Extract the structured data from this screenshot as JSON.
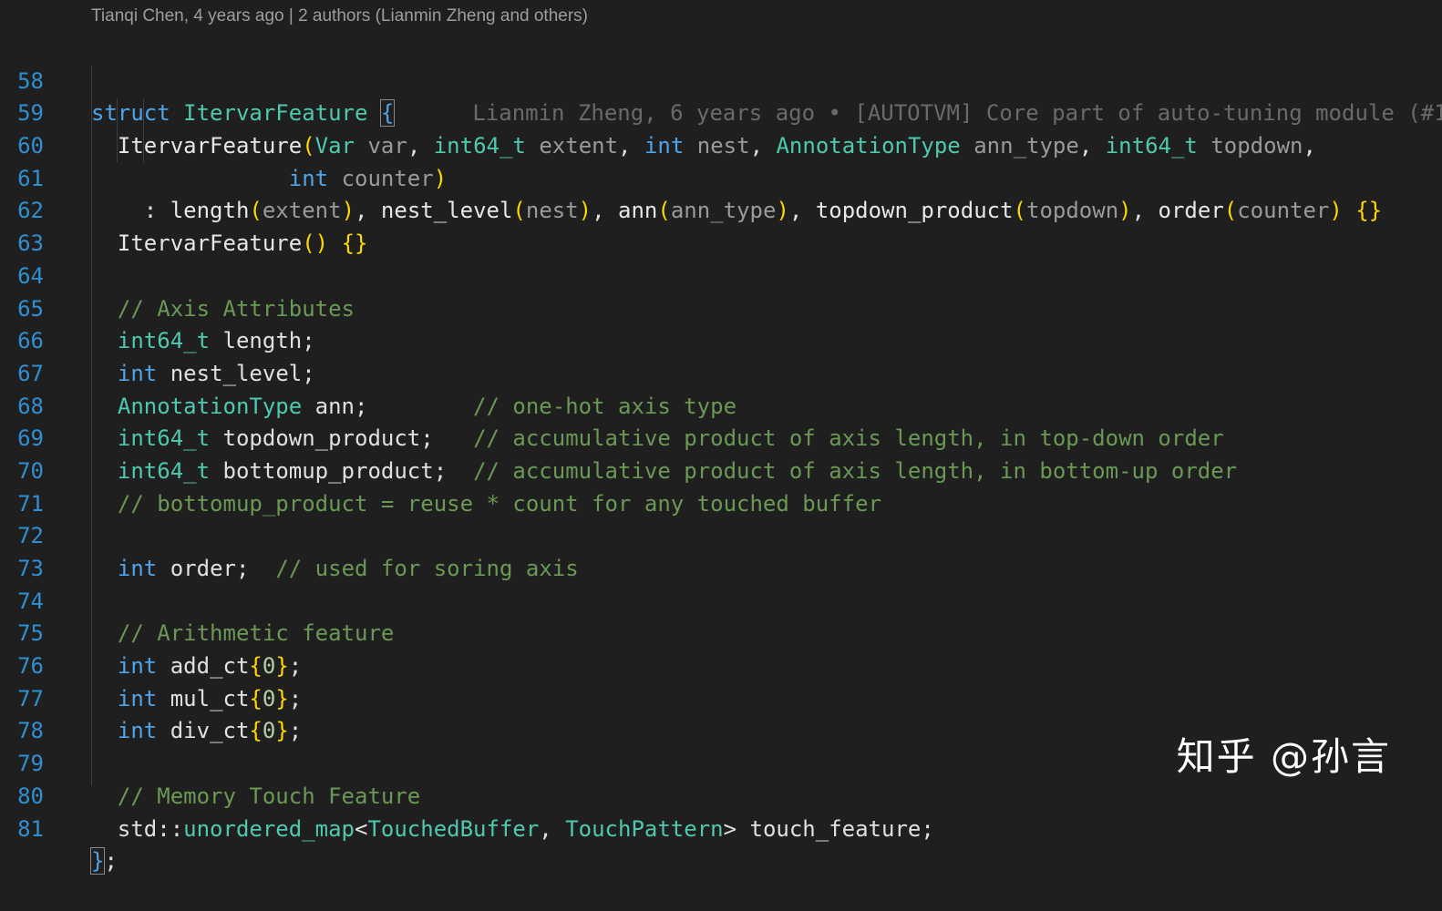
{
  "codelens": "Tianqi Chen, 4 years ago | 2 authors (Lianmin Zheng and others)",
  "blame": "Lianmin Zheng, 6 years ago • [AUTOTVM] Core part of auto-tuning module (#1",
  "watermark": "知乎 @孙言",
  "line_numbers": [
    "58",
    "59",
    "60",
    "61",
    "62",
    "63",
    "64",
    "65",
    "66",
    "67",
    "68",
    "69",
    "70",
    "71",
    "72",
    "73",
    "74",
    "75",
    "76",
    "77",
    "78",
    "79",
    "80",
    "81"
  ],
  "code": {
    "l58": {
      "kw": "struct",
      "name": "ItervarFeature",
      "open": "{"
    },
    "l59": {
      "fn": "ItervarFeature",
      "p_open": "(",
      "t1": "Var",
      "a1": "var",
      "t2": "int64_t",
      "a2": "extent",
      "t3": "int",
      "a3": "nest",
      "t4": "AnnotationType",
      "a4": "ann_type",
      "t5": "int64_t",
      "a5": "topdown"
    },
    "l60": {
      "t": "int",
      "a": "counter",
      "p_close": ")"
    },
    "l61": {
      "colon": ": ",
      "m1": "length",
      "v1": "extent",
      "m2": "nest_level",
      "v2": "nest",
      "m3": "ann",
      "v3": "ann_type",
      "m4": "topdown_product",
      "v4": "topdown",
      "m5": "order",
      "v5": "counter",
      "body": "{}"
    },
    "l62": {
      "fn": "ItervarFeature",
      "parens": "()",
      "body": "{}"
    },
    "l64": {
      "comment": "// Axis Attributes"
    },
    "l65": {
      "type": "int64_t",
      "rest": "length;"
    },
    "l66": {
      "type": "int",
      "rest": "nest_level;"
    },
    "l67": {
      "type": "AnnotationType",
      "rest": "ann;",
      "comment": "// one-hot axis type"
    },
    "l68": {
      "type": "int64_t",
      "rest": "topdown_product;",
      "comment": "// accumulative product of axis length, in top-down order"
    },
    "l69": {
      "type": "int64_t",
      "rest": "bottomup_product;",
      "comment": "// accumulative product of axis length, in bottom-up order"
    },
    "l70": {
      "comment": "// bottomup_product = reuse * count for any touched buffer"
    },
    "l72": {
      "type": "int",
      "rest": "order;",
      "comment": "// used for soring axis"
    },
    "l74": {
      "comment": "// Arithmetic feature"
    },
    "l75": {
      "type": "int",
      "name": "add_ct",
      "val": "0"
    },
    "l76": {
      "type": "int",
      "name": "mul_ct",
      "val": "0"
    },
    "l77": {
      "type": "int",
      "name": "div_ct",
      "val": "0"
    },
    "l79": {
      "comment": "// Memory Touch Feature"
    },
    "l80": {
      "ns": "std::",
      "tmpl": "unordered_map",
      "t1": "TouchedBuffer",
      "t2": "TouchPattern",
      "rest": "touch_feature;"
    },
    "l81": {
      "close": "}",
      "semi": ";"
    }
  },
  "colors": {
    "background": "#1f1f1f",
    "line_number": "#2f8fd0",
    "keyword": "#4fa4e8",
    "type": "#4ec9b0",
    "comment": "#6a9955",
    "bracket": "#ffd700",
    "param": "#9a9a9a"
  }
}
